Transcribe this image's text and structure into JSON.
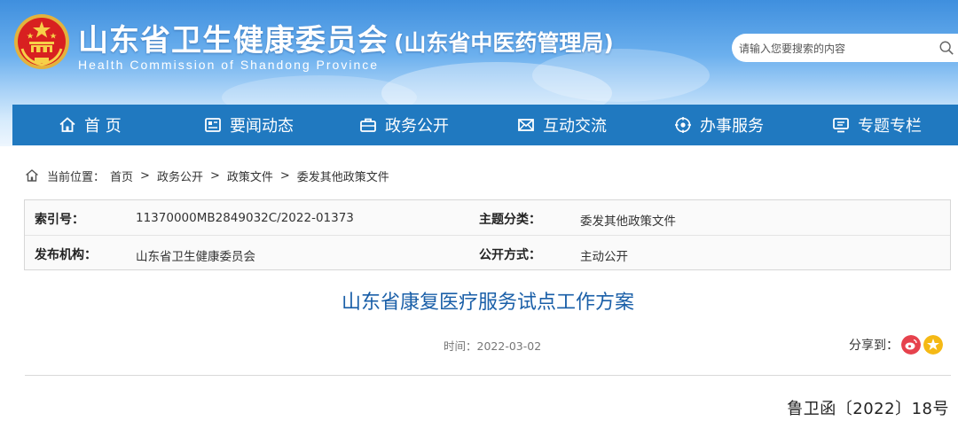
{
  "header": {
    "title": "山东省卫生健康委员会",
    "subtitle": "(山东省中医药管理局)",
    "title_en": "Health Commission of Shandong Province",
    "emblem_icon": "national-emblem-icon"
  },
  "search": {
    "placeholder": "请输入您要搜索的内容",
    "icon": "search-icon"
  },
  "nav": {
    "items": [
      {
        "label": "首 页",
        "icon": "home-icon"
      },
      {
        "label": "要闻动态",
        "icon": "newspaper-icon"
      },
      {
        "label": "政务公开",
        "icon": "briefcase-icon"
      },
      {
        "label": "互动交流",
        "icon": "mail-icon"
      },
      {
        "label": "办事服务",
        "icon": "service-icon"
      },
      {
        "label": "专题专栏",
        "icon": "monitor-icon"
      }
    ]
  },
  "breadcrumb": {
    "prefix": "当前位置：",
    "items": [
      "首页",
      "政务公开",
      "政策文件",
      "委发其他政策文件"
    ],
    "separator": ">"
  },
  "info": {
    "index_label": "索引号：",
    "index_value": "11370000MB2849032C/2022-01373",
    "category_label": "主题分类：",
    "category_value": "委发其他政策文件",
    "publisher_label": "发布机构：",
    "publisher_value": "山东省卫生健康委员会",
    "disclosure_label": "公开方式：",
    "disclosure_value": "主动公开"
  },
  "article": {
    "title": "山东省康复医疗服务试点工作方案",
    "time_label": "时间：",
    "time_value": "2022-03-02",
    "share_label": "分享到：",
    "doc_number": "鲁卫函〔2022〕18号"
  },
  "colors": {
    "nav_bg": "#2079c0",
    "title_blue": "#1a5fa8",
    "weibo": "#e6424d",
    "qzone": "#f5b915"
  }
}
